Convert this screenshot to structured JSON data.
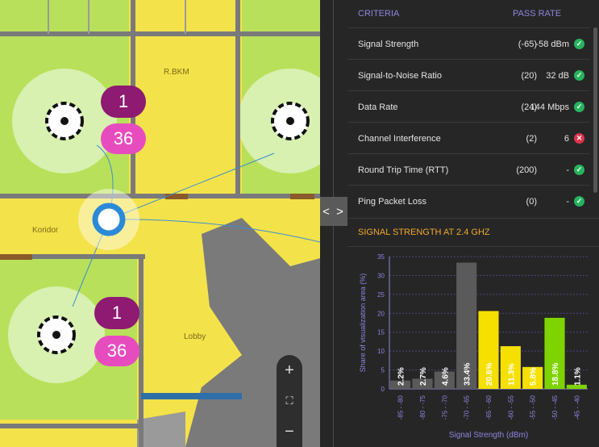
{
  "map": {
    "access_points": [
      {
        "count": "1",
        "sub": "36"
      },
      {
        "count": "1",
        "sub": "36"
      }
    ],
    "labels": [
      "R.BKM",
      "Koridor",
      "Lobby"
    ],
    "zoom": {
      "in": "+",
      "fit": "⛶",
      "out": "−"
    }
  },
  "splitter": {
    "toggle_label": "< >"
  },
  "criteria": {
    "header_left": "CRITERIA",
    "header_right": "PASS RATE",
    "rows": [
      {
        "name": "Signal Strength",
        "threshold": "(-65)",
        "value": "-58 dBm",
        "status": "pass"
      },
      {
        "name": "Signal-to-Noise Ratio",
        "threshold": "(20)",
        "value": "32 dB",
        "status": "pass"
      },
      {
        "name": "Data Rate",
        "threshold": "(24)",
        "value": "144 Mbps",
        "status": "pass"
      },
      {
        "name": "Channel Interference",
        "threshold": "(2)",
        "value": "6",
        "status": "fail"
      },
      {
        "name": "Round Trip Time (RTT)",
        "threshold": "(200)",
        "value": "-",
        "status": "pass"
      },
      {
        "name": "Ping Packet Loss",
        "threshold": "(0)",
        "value": "-",
        "status": "pass"
      }
    ]
  },
  "section_title": "SIGNAL STRENGTH AT 2.4 GHZ",
  "colors": {
    "pass": "#27b45e",
    "fail": "#e0334d",
    "accent": "#f0a830",
    "criteria": "#8d86e0"
  },
  "chart_data": {
    "type": "bar",
    "categories": [
      "-85 - -80",
      "-80 - -75",
      "-75 - -70",
      "-70 - -65",
      "-65 - -60",
      "-60 - -55",
      "-55 - -50",
      "-50 - -45",
      "-45 - -40"
    ],
    "values": [
      2.2,
      2.7,
      4.6,
      33.4,
      20.6,
      11.3,
      5.8,
      18.8,
      1.1
    ],
    "labels": [
      "2.2%",
      "2.7%",
      "4.6%",
      "33.4%",
      "20.6%",
      "11.3%",
      "5.8%",
      "18.8%",
      "1.1%"
    ],
    "colors": [
      "#5a5a5a",
      "#5a5a5a",
      "#5a5a5a",
      "#5a5a5a",
      "#f5e000",
      "#f5e000",
      "#f5e000",
      "#7fd400",
      "#7fd400"
    ],
    "xlabel": "Signal Strength (dBm)",
    "ylabel": "Share of visualization area (%)",
    "ylim": [
      0,
      35
    ],
    "yticks": [
      0,
      5,
      10,
      15,
      20,
      25,
      30,
      35
    ],
    "grid": true
  }
}
